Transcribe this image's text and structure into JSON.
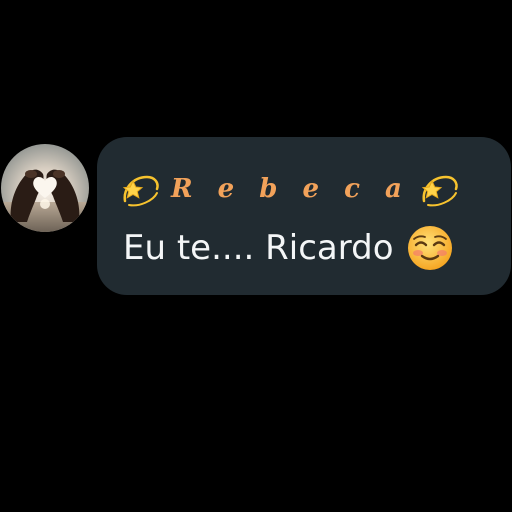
{
  "avatar": {
    "icon": "heart-hands-photo-avatar"
  },
  "message": {
    "sender_name": "Rebeca",
    "sender_name_display": "R e b e c a",
    "text": "Eu te.... Ricardo",
    "leading_icon": "dizzy-star-icon",
    "trailing_icon": "dizzy-star-icon",
    "emoji": "smiling-face-icon"
  },
  "colors": {
    "background": "#000000",
    "bubble": "#212b31",
    "sender_name": "#f2a25a",
    "message_text": "#f4f6f7"
  }
}
